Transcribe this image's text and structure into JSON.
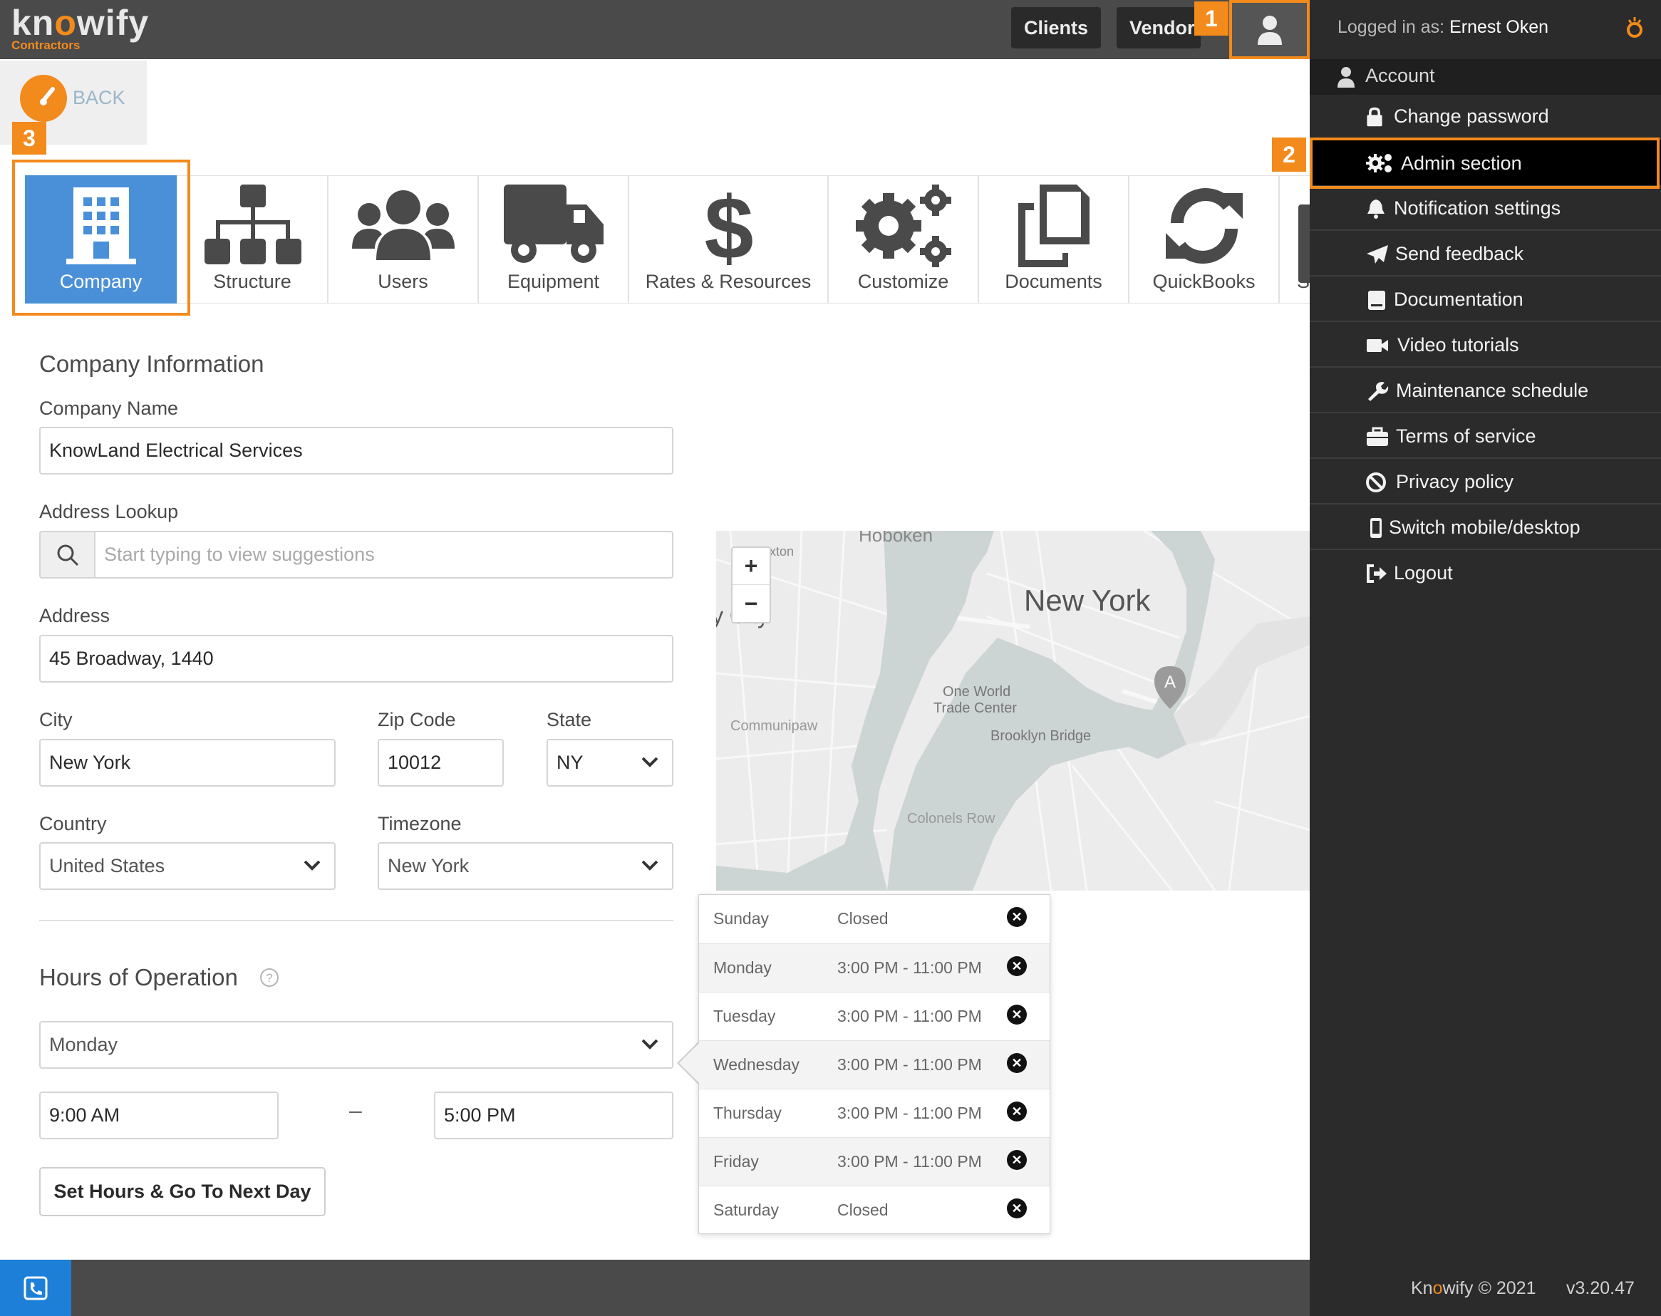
{
  "brand": {
    "name_pre": "kn",
    "name_o": "o",
    "name_post": "wify",
    "sub": "Contractors"
  },
  "topbar": {
    "clients": "Clients",
    "vendors": "Vendor"
  },
  "annotations": {
    "one": "1",
    "two": "2",
    "three": "3"
  },
  "back": {
    "label": "BACK"
  },
  "tabs": [
    {
      "label": "Company",
      "icon": "building-icon"
    },
    {
      "label": "Structure",
      "icon": "org-chart-icon"
    },
    {
      "label": "Users",
      "icon": "users-icon"
    },
    {
      "label": "Equipment",
      "icon": "truck-icon"
    },
    {
      "label": "Rates & Resources",
      "icon": "dollar-icon"
    },
    {
      "label": "Customize",
      "icon": "gears-icon"
    },
    {
      "label": "Documents",
      "icon": "documents-icon"
    },
    {
      "label": "QuickBooks",
      "icon": "sync-icon"
    },
    {
      "label": "Su",
      "icon": "mobile-icon"
    }
  ],
  "company": {
    "section_title": "Company Information",
    "name_label": "Company Name",
    "name_value": "KnowLand Electrical Services",
    "lookup_label": "Address Lookup",
    "lookup_placeholder": "Start typing to view suggestions",
    "address_label": "Address",
    "address_value": "45 Broadway, 1440",
    "city_label": "City",
    "city_value": "New York",
    "zip_label": "Zip Code",
    "zip_value": "10012",
    "state_label": "State",
    "state_value": "NY",
    "country_label": "Country",
    "country_value": "United States",
    "timezone_label": "Timezone",
    "timezone_value": "New York"
  },
  "map": {
    "labels": {
      "hoboken": "Hoboken",
      "newyork": "New York",
      "owtc1": "One World",
      "owtc2": "Trade Center",
      "brooklyn": "Brooklyn Bridge",
      "communipaw": "Communipaw",
      "colonels": "Colonels Row",
      "marker": "A",
      "city_fragment": "y City",
      "xton": "xton"
    },
    "zoom_in": "+",
    "zoom_out": "−"
  },
  "hours": {
    "title": "Hours of Operation",
    "day_select": "Monday",
    "start": "9:00 AM",
    "dash": "–",
    "end": "5:00 PM",
    "set_button": "Set Hours & Go To Next Day",
    "schedule": [
      {
        "day": "Sunday",
        "time": "Closed"
      },
      {
        "day": "Monday",
        "time": "3:00 PM - 11:00 PM"
      },
      {
        "day": "Tuesday",
        "time": "3:00 PM - 11:00 PM"
      },
      {
        "day": "Wednesday",
        "time": "3:00 PM - 11:00 PM"
      },
      {
        "day": "Thursday",
        "time": "3:00 PM - 11:00 PM"
      },
      {
        "day": "Friday",
        "time": "3:00 PM - 11:00 PM"
      },
      {
        "day": "Saturday",
        "time": "Closed"
      }
    ]
  },
  "panel": {
    "logged_in_prefix": "Logged in as:",
    "user": "Ernest Oken",
    "account": "Account",
    "items": [
      {
        "label": "Change password",
        "icon": "lock-icon"
      },
      {
        "label": "Admin section",
        "icon": "gears-icon"
      },
      {
        "label": "Notification settings",
        "icon": "bell-icon"
      },
      {
        "label": "Send feedback",
        "icon": "paper-plane-icon"
      },
      {
        "label": "Documentation",
        "icon": "book-icon"
      },
      {
        "label": "Video tutorials",
        "icon": "video-icon"
      },
      {
        "label": "Maintenance schedule",
        "icon": "wrench-icon"
      },
      {
        "label": "Terms of service",
        "icon": "briefcase-icon"
      },
      {
        "label": "Privacy policy",
        "icon": "ban-icon"
      },
      {
        "label": "Switch mobile/desktop",
        "icon": "mobile-icon"
      },
      {
        "label": "Logout",
        "icon": "logout-icon"
      }
    ],
    "footer_pre": "Kn",
    "footer_o": "o",
    "footer_post": "wify © 2021",
    "version": "v3.20.47"
  },
  "colors": {
    "accent": "#f38a1c",
    "active_tab": "#4a90d9",
    "panel": "#2b2b2b",
    "topbar": "#4a4a4a",
    "phone": "#1e7fd9"
  }
}
